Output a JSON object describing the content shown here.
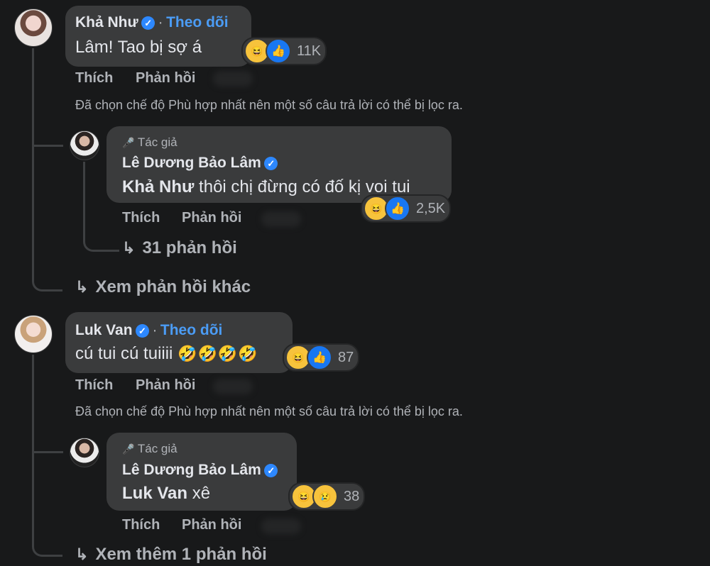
{
  "actions": {
    "like": "Thích",
    "reply": "Phản hồi"
  },
  "filter_note": "Đã chọn chế độ Phù hợp nhất nên một số câu trả lời có thể bị lọc ra.",
  "comments": [
    {
      "name": "Khả Như",
      "follow": "Theo dõi",
      "text": "Lâm! Tao bị sợ á",
      "reaction_count": "11K",
      "reply": {
        "author_tag": "Tác giả",
        "name": "Lê Dương Bảo Lâm",
        "mention": "Khả Như",
        "text": " thôi chị đừng có đố kị voi tui",
        "reaction_count": "2,5K",
        "sub_replies": "31 phản hồi"
      },
      "more_link": "Xem phản hồi khác"
    },
    {
      "name": "Luk Van",
      "follow": "Theo dõi",
      "text": "cú tui cú tuiiii",
      "laugh_emojis": "🤣🤣🤣🤣",
      "reaction_count": "87",
      "reply": {
        "author_tag": "Tác giả",
        "name": "Lê Dương Bảo Lâm",
        "mention": "Luk Van",
        "text": " xê",
        "reaction_count": "38"
      },
      "more_link": "Xem thêm 1 phản hồi"
    }
  ],
  "icons": {
    "verified": "✓",
    "haha": "😆",
    "like": "👍",
    "sad": "😢",
    "reply_arrow": "↳",
    "author_mic": "🎤"
  }
}
